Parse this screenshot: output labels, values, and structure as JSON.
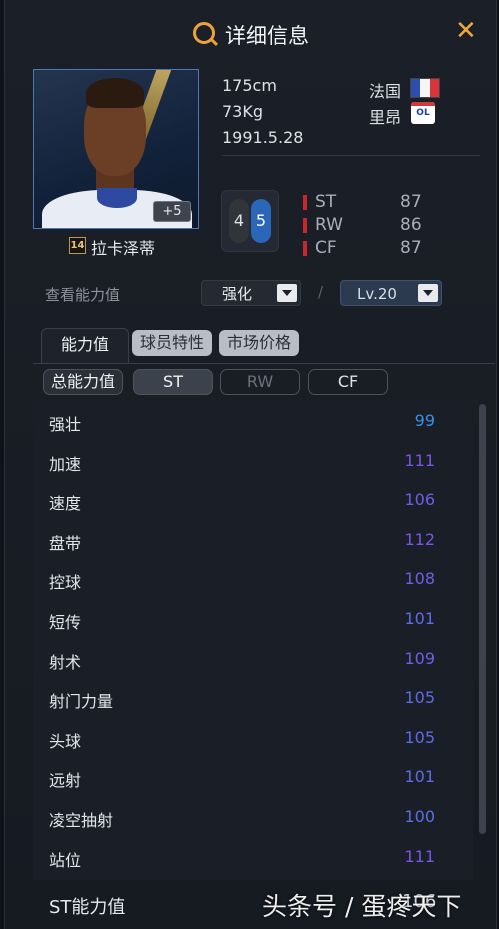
{
  "header": {
    "title": "详细信息",
    "close_symbol": "✕"
  },
  "player": {
    "height": "175cm",
    "weight": "73Kg",
    "birthdate": "1991.5.28",
    "nationality": "法国",
    "club": "里昂",
    "club_logo_text": "OL",
    "name": "拉卡泽蒂",
    "season_badge": "14",
    "plus_level": "+5",
    "weak_foot": "4",
    "strong_foot": "5"
  },
  "positions": [
    {
      "name": "ST",
      "rating": "87"
    },
    {
      "name": "RW",
      "rating": "86"
    },
    {
      "name": "CF",
      "rating": "87"
    }
  ],
  "view_controls": {
    "label": "查看能力值",
    "enhance_select": "强化",
    "separator": "/",
    "level_select": "Lv.20"
  },
  "tabs": [
    {
      "label": "能力值"
    },
    {
      "label": "球员特性"
    },
    {
      "label": "市场价格"
    }
  ],
  "position_tabs": [
    {
      "label": "总能力值"
    },
    {
      "label": "ST"
    },
    {
      "label": "RW"
    },
    {
      "label": "CF"
    }
  ],
  "stats": [
    {
      "name": "强壮",
      "value": "99",
      "color": "#3b8ee8"
    },
    {
      "name": "加速",
      "value": "111",
      "color": "#7a55e6"
    },
    {
      "name": "速度",
      "value": "106",
      "color": "#6d5fe6"
    },
    {
      "name": "盘带",
      "value": "112",
      "color": "#7a55e6"
    },
    {
      "name": "控球",
      "value": "108",
      "color": "#6d5fe6"
    },
    {
      "name": "短传",
      "value": "101",
      "color": "#5f6be6"
    },
    {
      "name": "射术",
      "value": "109",
      "color": "#6d5fe6"
    },
    {
      "name": "射门力量",
      "value": "105",
      "color": "#5f6be6"
    },
    {
      "name": "头球",
      "value": "105",
      "color": "#5f6be6"
    },
    {
      "name": "远射",
      "value": "101",
      "color": "#5f6be6"
    },
    {
      "name": "凌空抽射",
      "value": "100",
      "color": "#5a6fe6"
    },
    {
      "name": "站位",
      "value": "111",
      "color": "#7a55e6"
    }
  ],
  "summary": {
    "label": "ST能力值",
    "value": "106"
  },
  "watermark": "头条号 / 蛋疼天下",
  "colors": {
    "accent": "#f0a23a",
    "position_bar": "#c8262b",
    "strong_foot": "#2a67b8"
  }
}
